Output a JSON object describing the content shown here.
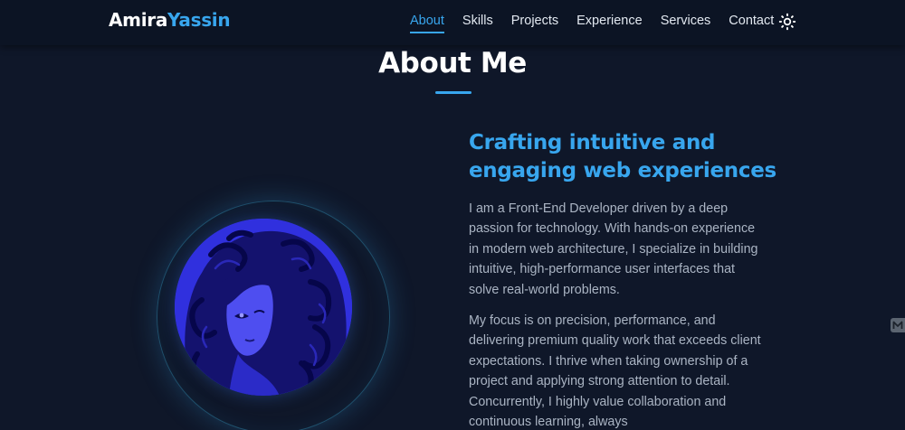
{
  "brand": {
    "first": "Amira",
    "last": "Yassin"
  },
  "nav": {
    "items": [
      {
        "label": "About",
        "active": true
      },
      {
        "label": "Skills",
        "active": false
      },
      {
        "label": "Projects",
        "active": false
      },
      {
        "label": "Experience",
        "active": false
      },
      {
        "label": "Services",
        "active": false
      },
      {
        "label": "Contact",
        "active": false
      }
    ],
    "theme_toggle_icon": "sun-icon"
  },
  "about": {
    "title": "About Me",
    "headline": "Crafting intuitive and engaging web experiences",
    "paragraphs": [
      "I am a Front-End Developer driven by a deep passion for technology. With hands-on experience in modern web architecture, I specialize in building intuitive, high-performance user interfaces that solve real-world problems.",
      "My focus is on precision, performance, and delivering premium quality work that exceeds client expectations. I thrive when taking ownership of a project and applying strong attention to detail. Concurrently, I highly value collaboration and continuous learning, always"
    ]
  },
  "colors": {
    "background": "#0f1729",
    "navbar": "#0c1424",
    "accent": "#38a6ee",
    "heading": "#ffffff",
    "body_text": "#aab4c3"
  },
  "icons": {
    "side_widget": "m-icon"
  }
}
